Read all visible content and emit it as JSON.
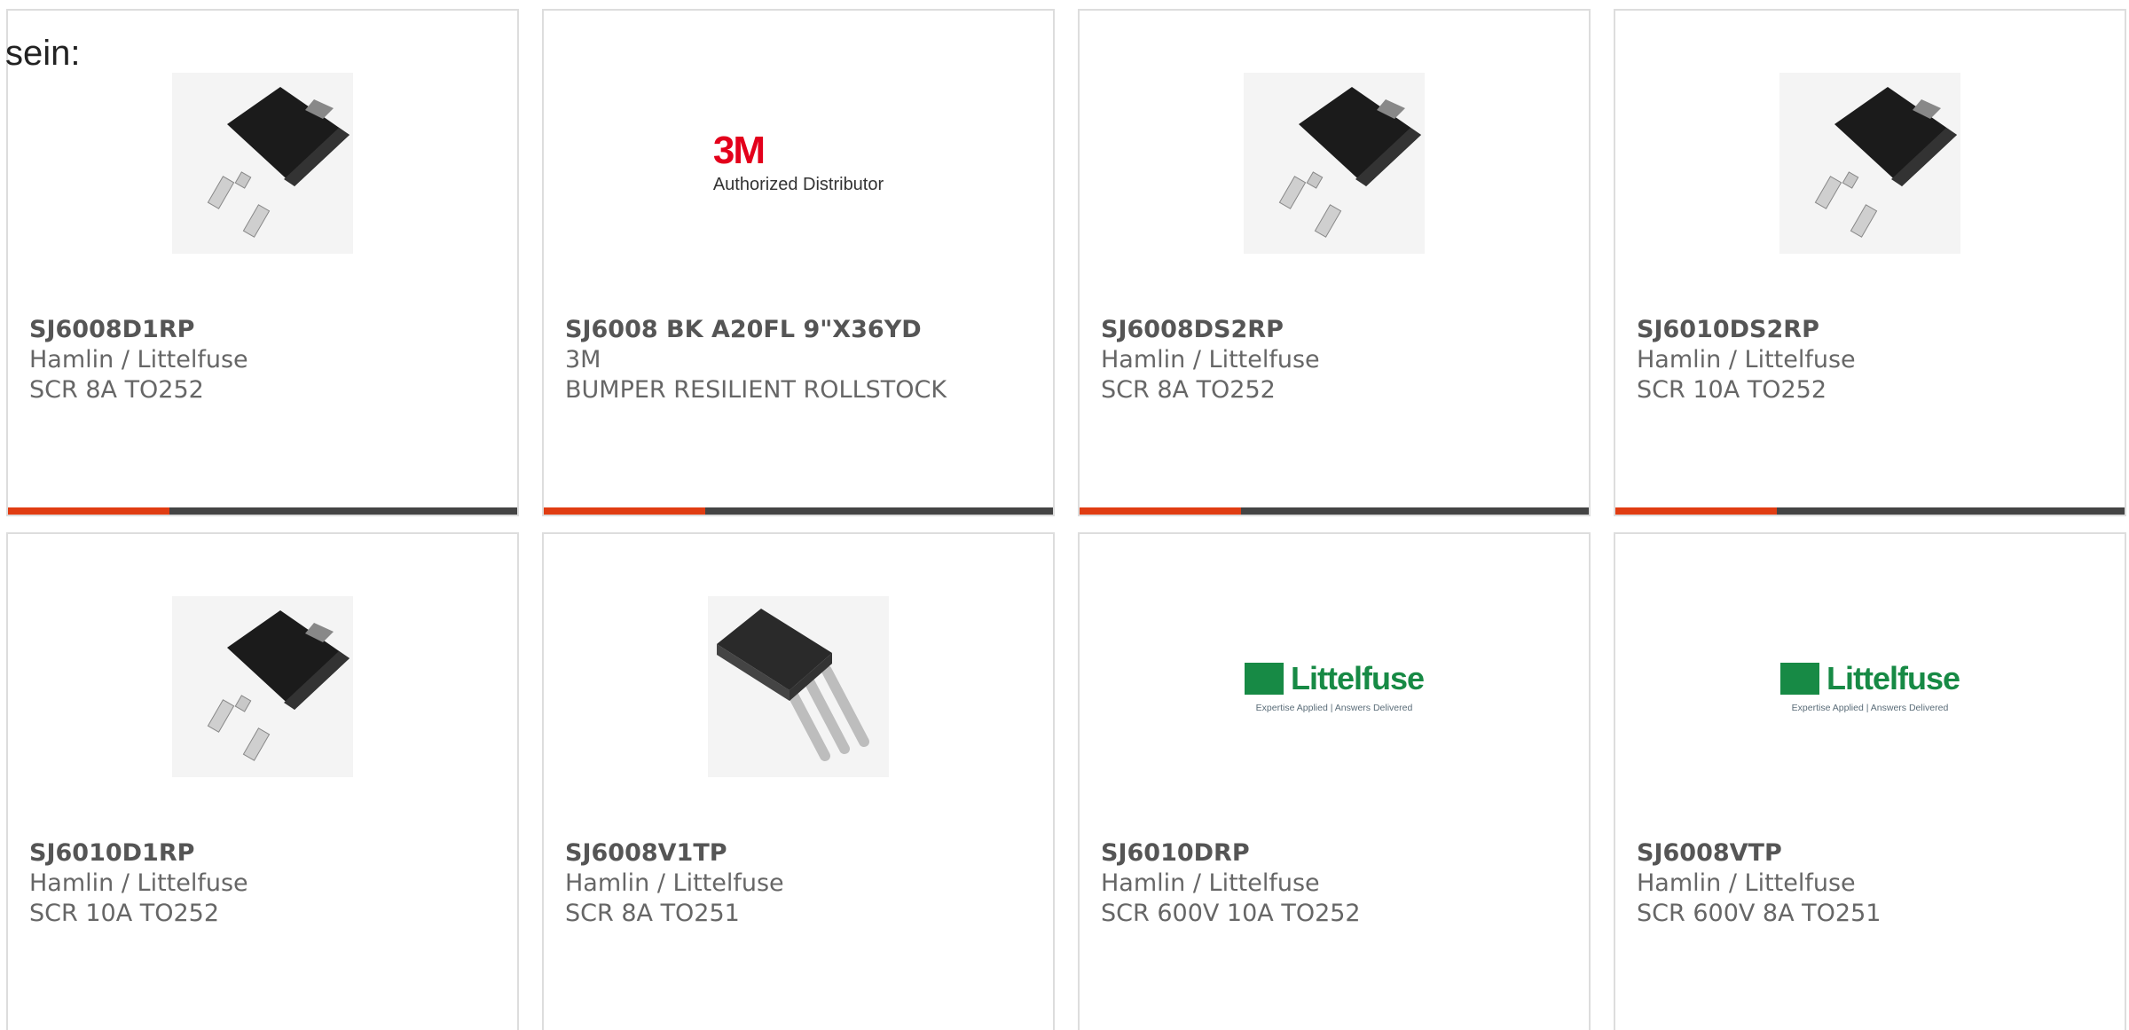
{
  "intro_text": "sein:",
  "brand_colors": {
    "accent": "#e03c12",
    "bar": "#444444",
    "littelfuse_green": "#178a45",
    "three_m_red": "#e3001b"
  },
  "products": [
    {
      "part_number": "SJ6008D1RP",
      "manufacturer": "Hamlin / Littelfuse",
      "description": "SCR 8A TO252",
      "image": "to252-package-icon"
    },
    {
      "part_number": "SJ6008 BK A20FL 9\"X36YD",
      "manufacturer": "3M",
      "description": "BUMPER RESILIENT ROLLSTOCK",
      "image": "3m-logo",
      "logo": {
        "mark": "3M",
        "subtitle": "Authorized Distributor"
      }
    },
    {
      "part_number": "SJ6008DS2RP",
      "manufacturer": "Hamlin / Littelfuse",
      "description": "SCR 8A TO252",
      "image": "to252-package-icon"
    },
    {
      "part_number": "SJ6010DS2RP",
      "manufacturer": "Hamlin / Littelfuse",
      "description": "SCR 10A TO252",
      "image": "to252-package-icon"
    },
    {
      "part_number": "SJ6010D1RP",
      "manufacturer": "Hamlin / Littelfuse",
      "description": "SCR 10A TO252",
      "image": "to252-package-icon"
    },
    {
      "part_number": "SJ6008V1TP",
      "manufacturer": "Hamlin / Littelfuse",
      "description": "SCR 8A TO251",
      "image": "to251-package-icon"
    },
    {
      "part_number": "SJ6010DRP",
      "manufacturer": "Hamlin / Littelfuse",
      "description": "SCR 600V 10A TO252",
      "image": "littelfuse-logo",
      "logo": {
        "name": "Littelfuse",
        "tagline": "Expertise Applied | Answers Delivered"
      }
    },
    {
      "part_number": "SJ6008VTP",
      "manufacturer": "Hamlin / Littelfuse",
      "description": "SCR 600V 8A TO251",
      "image": "littelfuse-logo",
      "logo": {
        "name": "Littelfuse",
        "tagline": "Expertise Applied | Answers Delivered"
      }
    }
  ]
}
